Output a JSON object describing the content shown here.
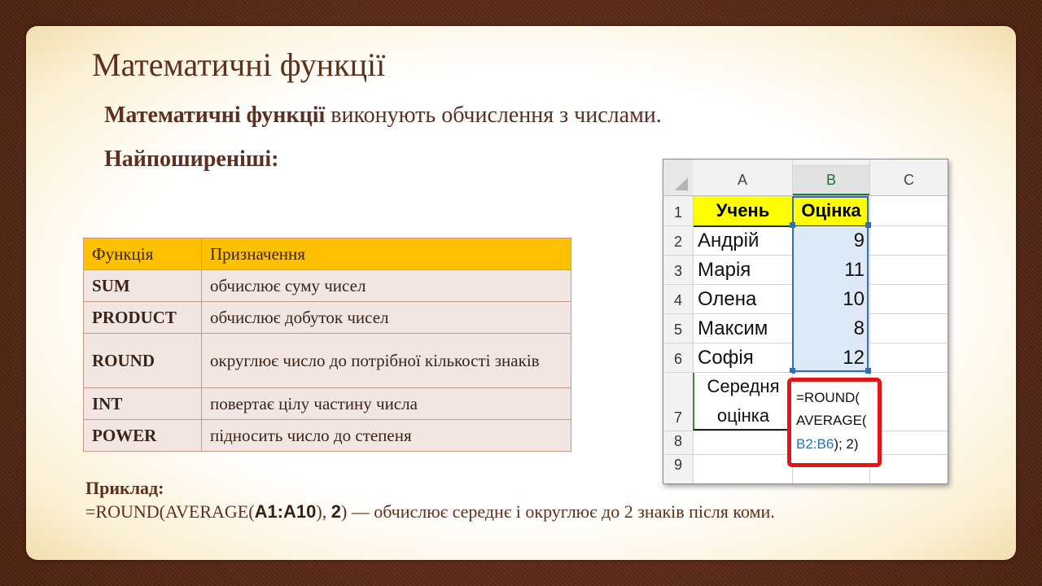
{
  "slide": {
    "title": "Математичні функції",
    "intro_bold": "Математичні функції",
    "intro_rest": " виконують обчислення з числами.",
    "subheading": "Найпоширеніші:"
  },
  "functions_table": {
    "headers": [
      "Функція",
      "Призначення"
    ],
    "rows": [
      {
        "name": "SUM",
        "desc": "обчислює суму чисел"
      },
      {
        "name": "PRODUCT",
        "desc": "обчислює добуток чисел"
      },
      {
        "name": "ROUND",
        "desc": "округлює число до потрібної кількості знаків"
      },
      {
        "name": "INT",
        "desc": "повертає цілу частину числа"
      },
      {
        "name": "POWER",
        "desc": "підносить число до степеня"
      }
    ]
  },
  "spreadsheet": {
    "columns": [
      "A",
      "B",
      "C"
    ],
    "rows": [
      "1",
      "2",
      "3",
      "4",
      "5",
      "6",
      "7",
      "8",
      "9"
    ],
    "header_a": "Учень",
    "header_b": "Оцінка",
    "students": [
      {
        "name": "Андрій",
        "grade": "9"
      },
      {
        "name": "Марія",
        "grade": "11"
      },
      {
        "name": "Олена",
        "grade": "10"
      },
      {
        "name": "Максим",
        "grade": "8"
      },
      {
        "name": "Софія",
        "grade": "12"
      }
    ],
    "avg_label_1": "Середня",
    "avg_label_2": "оцінка",
    "formula_1": "=ROUND(",
    "formula_2": "AVERAGE(",
    "formula_ref": "B2:B6",
    "formula_end": "); 2)"
  },
  "example": {
    "label": "Приклад:",
    "part1": "=ROUND(AVERAGE(",
    "arg1": "A1:A10",
    "part2": "), ",
    "arg2": "2",
    "part3": ") — обчислює середнє і округлює до 2 знаків після коми."
  },
  "colors": {
    "accent_brown": "#5e2f1e",
    "table_header": "#ffc000",
    "excel_header_yellow": "#ffff00",
    "selection_blue": "#2f6fb7",
    "highlight_red": "#e0161b"
  }
}
